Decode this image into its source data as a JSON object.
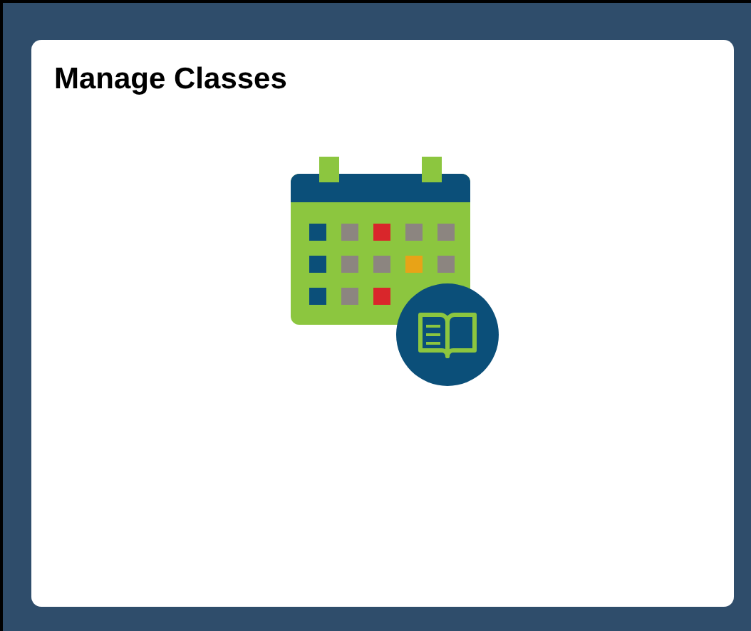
{
  "tile": {
    "title": "Manage Classes"
  }
}
